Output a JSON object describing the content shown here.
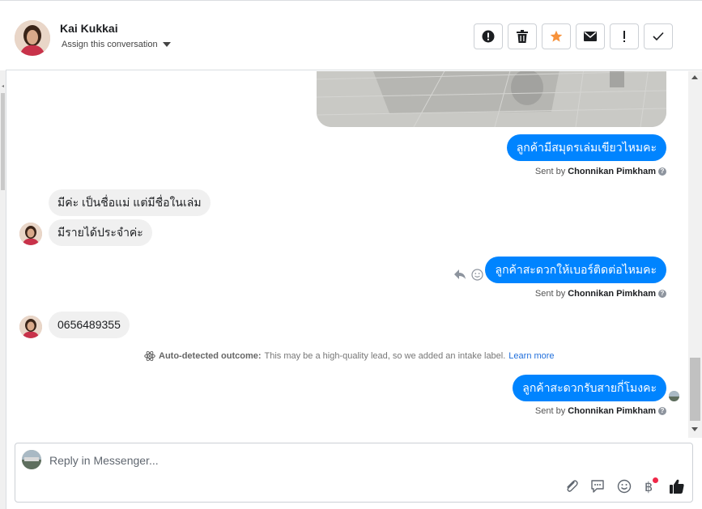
{
  "header": {
    "name": "Kai Kukkai",
    "assign_label": "Assign this conversation"
  },
  "toolbar": [
    {
      "name": "spam",
      "icon": "alert-octagon-icon"
    },
    {
      "name": "delete",
      "icon": "trash-icon"
    },
    {
      "name": "star",
      "icon": "star-icon",
      "color": "#f7923b"
    },
    {
      "name": "mark-unread",
      "icon": "envelope-icon"
    },
    {
      "name": "follow-up",
      "icon": "exclamation-icon"
    },
    {
      "name": "done",
      "icon": "check-icon"
    }
  ],
  "messages": {
    "out1": {
      "text": "ลูกค้ามีสมุดรเล่มเขียวไหมคะ",
      "sent_prefix": "Sent by",
      "sender": "Chonnikan Pimkham"
    },
    "in1": {
      "text": "มีค่ะ เป็นชื่อแม่ แต่มีชื่อในเล่ม"
    },
    "in2": {
      "text": "มีรายได้ประจำค่ะ"
    },
    "out2": {
      "text": "ลูกค้าสะดวกให้เบอร์ติดต่อไหมคะ",
      "sent_prefix": "Sent by",
      "sender": "Chonnikan Pimkham"
    },
    "in3": {
      "text": "0656489355"
    },
    "auto_note": {
      "label": "Auto-detected outcome:",
      "text": "This may be a high-quality lead, so we added an intake label.",
      "link": "Learn more"
    },
    "out3": {
      "text": "ลูกค้าสะดวกรับสายกี่โมงคะ",
      "sent_prefix": "Sent by",
      "sender": "Chonnikan Pimkham"
    }
  },
  "composer": {
    "placeholder": "Reply in Messenger...",
    "icons": [
      "paperclip-icon",
      "saved-reply-icon",
      "emoji-icon",
      "baht-payment-icon",
      "thumbs-up-icon"
    ]
  },
  "colors": {
    "accent": "#0084ff",
    "star": "#f7923b",
    "link": "#216fdb",
    "badge": "#f02849"
  }
}
